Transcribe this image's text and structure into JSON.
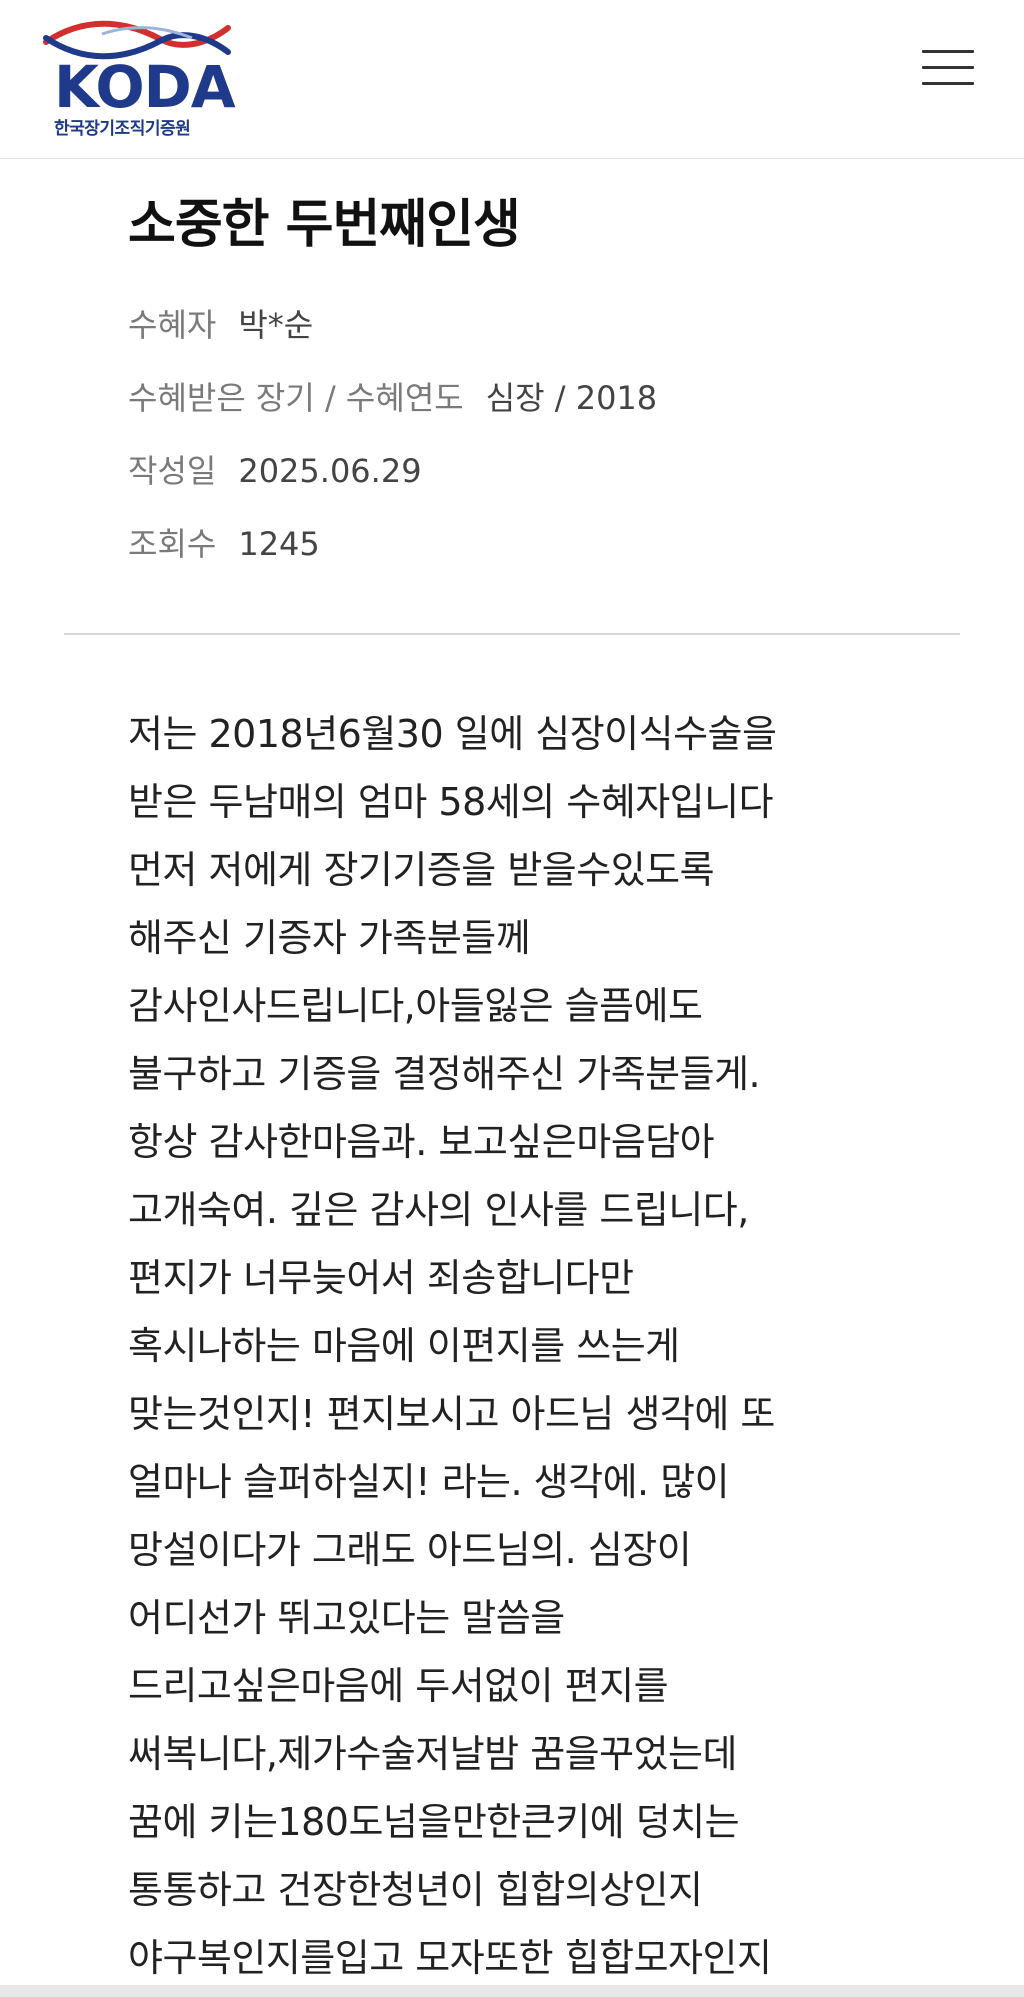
{
  "header": {
    "logo_text": "KODA",
    "logo_subtitle": "한국장기조직기증원"
  },
  "post": {
    "title": "소중한 두번째인생",
    "meta": [
      {
        "label": "수혜자",
        "value": "박*순"
      },
      {
        "label": "수혜받은 장기 / 수혜연도",
        "value": "심장 / 2018"
      },
      {
        "label": "작성일",
        "value": "2025.06.29"
      },
      {
        "label": "조회수",
        "value": "1245"
      }
    ],
    "body_lines": [
      "저는 2018년6월30 일에 심장이식수술을",
      "받은 두남매의 엄마 58세의 수혜자입니다",
      "먼저 저에게 장기기증을 받을수있도록",
      "해주신 기증자 가족분들께",
      "감사인사드립니다,아들잃은 슬픔에도",
      "불구하고 기증을 결정해주신 가족분들게.",
      "항상 감사한마음과. 보고싶은마음담아",
      "고개숙여. 깊은 감사의 인사를 드립니다,",
      "편지가 너무늦어서 죄송합니다만",
      "혹시나하는 마음에 이편지를 쓰는게",
      "맞는것인지! 편지보시고 아드님 생각에 또",
      "얼마나 슬퍼하실지! 라는. 생각에. 많이",
      "망설이다가 그래도 아드님의. 심장이",
      "어디선가 뛰고있다는 말씀을",
      "드리고싶은마음에 두서없이 편지를",
      "써복니다,제가수술저날밤 꿈을꾸었는데",
      "꿈에 키는180도넘을만한큰키에 덩치는",
      "통통하고 건장한청년이 힙합의상인지",
      "야구복인지를입고 모자또한 힙합모자인지"
    ]
  }
}
